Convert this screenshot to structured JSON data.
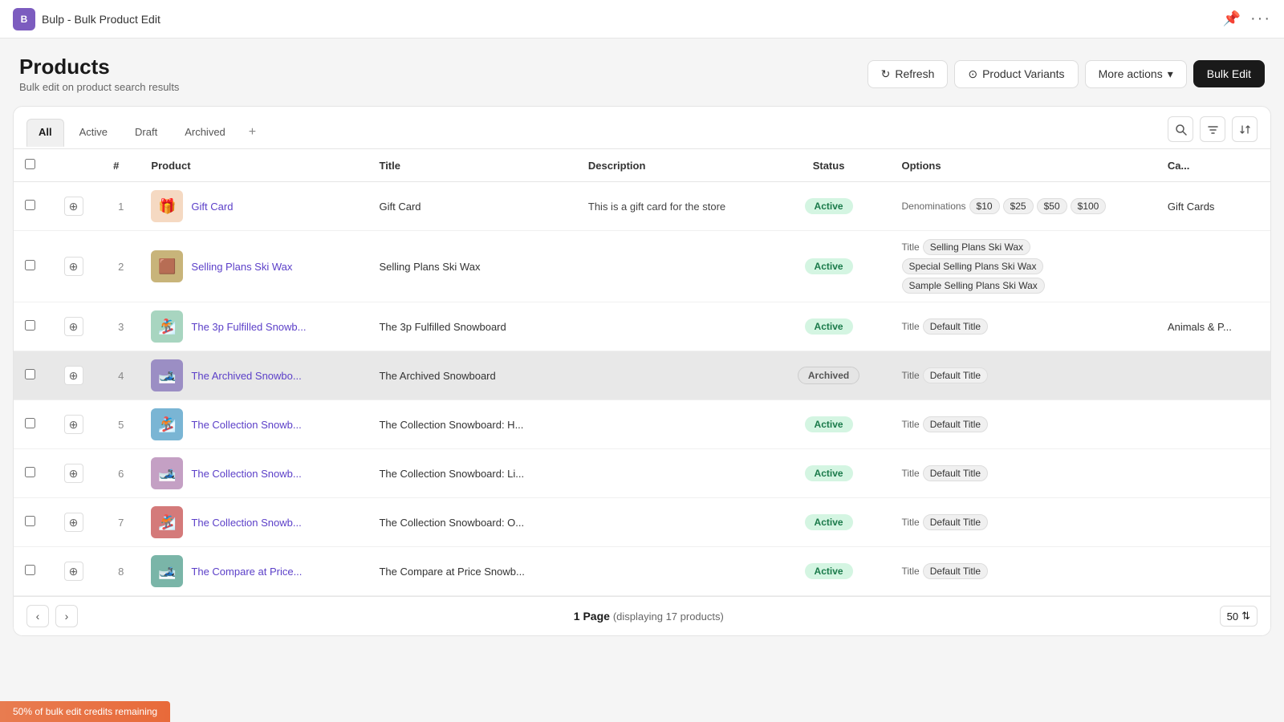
{
  "app": {
    "icon_label": "B",
    "title": "Bulp - Bulk Product Edit",
    "pin_icon": "📌",
    "more_icon": "···"
  },
  "header": {
    "title": "Products",
    "subtitle": "Bulk edit on product search results",
    "actions": {
      "refresh_label": "Refresh",
      "product_variants_label": "Product Variants",
      "more_actions_label": "More actions",
      "bulk_edit_label": "Bulk Edit"
    }
  },
  "tabs": [
    {
      "label": "All",
      "active": true
    },
    {
      "label": "Active",
      "active": false
    },
    {
      "label": "Draft",
      "active": false
    },
    {
      "label": "Archived",
      "active": false
    }
  ],
  "columns": {
    "product": "Product",
    "title": "Title",
    "description": "Description",
    "status": "Status",
    "options": "Options",
    "category": "Ca..."
  },
  "rows": [
    {
      "num": "1",
      "product_emoji": "🎁",
      "product_name": "Gift Card",
      "title": "Gift Card",
      "description": "This is a gift card for the store",
      "status": "Active",
      "status_type": "active",
      "options_label": "Denominations",
      "options_tags": [
        "$10",
        "$25",
        "$50",
        "$100"
      ],
      "category": "Gift Cards",
      "archived": false
    },
    {
      "num": "2",
      "product_emoji": "🟫",
      "product_name": "Selling Plans Ski Wax",
      "title": "Selling Plans Ski Wax",
      "description": "",
      "status": "Active",
      "status_type": "active",
      "options_label": "Title",
      "options_tags": [
        "Selling Plans Ski Wax",
        "Special Selling Plans Ski Wax",
        "Sample Selling Plans Ski Wax"
      ],
      "category": "",
      "archived": false
    },
    {
      "num": "3",
      "product_emoji": "🏂",
      "product_name": "The 3p Fulfilled Snowb...",
      "title": "The 3p Fulfilled Snowboard",
      "description": "",
      "status": "Active",
      "status_type": "active",
      "options_label": "Title",
      "options_tags": [
        "Default Title"
      ],
      "category": "Animals & P...",
      "archived": false
    },
    {
      "num": "4",
      "product_emoji": "🎿",
      "product_name": "The Archived Snowbo...",
      "title": "The Archived Snowboard",
      "description": "",
      "status": "Archived",
      "status_type": "archived",
      "options_label": "Title",
      "options_tags": [
        "Default Title"
      ],
      "category": "",
      "archived": true
    },
    {
      "num": "5",
      "product_emoji": "🏂",
      "product_name": "The Collection Snowb...",
      "title": "The Collection Snowboard: H...",
      "description": "",
      "status": "Active",
      "status_type": "active",
      "options_label": "Title",
      "options_tags": [
        "Default Title"
      ],
      "category": "",
      "archived": false
    },
    {
      "num": "6",
      "product_emoji": "🎿",
      "product_name": "The Collection Snowb...",
      "title": "The Collection Snowboard: Li...",
      "description": "",
      "status": "Active",
      "status_type": "active",
      "options_label": "Title",
      "options_tags": [
        "Default Title"
      ],
      "category": "",
      "archived": false
    },
    {
      "num": "7",
      "product_emoji": "🏂",
      "product_name": "The Collection Snowb...",
      "title": "The Collection Snowboard: O...",
      "description": "",
      "status": "Active",
      "status_type": "active",
      "options_label": "Title",
      "options_tags": [
        "Default Title"
      ],
      "category": "",
      "archived": false
    },
    {
      "num": "8",
      "product_emoji": "🎿",
      "product_name": "The Compare at Price...",
      "title": "The Compare at Price Snowb...",
      "description": "",
      "status": "Active",
      "status_type": "active",
      "options_label": "Title",
      "options_tags": [
        "Default Title"
      ],
      "category": "",
      "archived": false
    }
  ],
  "footer": {
    "page_label": "1 Page",
    "displaying": "(displaying 17 products)",
    "per_page": "50",
    "prev_icon": "‹",
    "next_icon": "›"
  },
  "bottom_banner": {
    "text": "50% of bulk edit credits remaining"
  }
}
